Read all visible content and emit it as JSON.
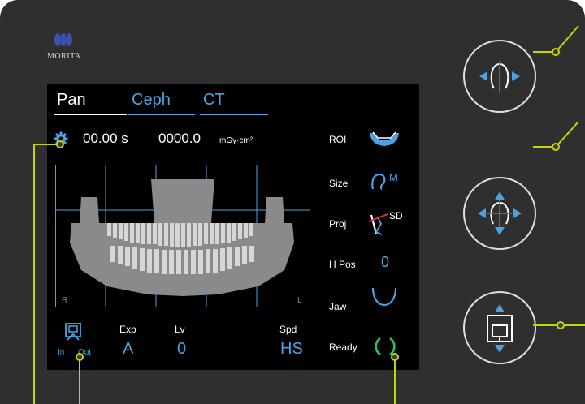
{
  "brand": {
    "name": "MORITA"
  },
  "tabs": [
    {
      "label": "Pan",
      "active": true
    },
    {
      "label": "Ceph",
      "active": false
    },
    {
      "label": "CT",
      "active": false
    }
  ],
  "status": {
    "time": "00.00 s",
    "dose": "0000.0",
    "dose_unit": "mGy·cm²"
  },
  "image": {
    "left_marker": "R",
    "right_marker": "L"
  },
  "settings": {
    "roi": "ROI",
    "size": "Size",
    "size_value": "M",
    "proj": "Proj",
    "proj_value": "SD",
    "hpos": "H Pos",
    "hpos_value": "0",
    "jaw": "Jaw",
    "ready": "Ready"
  },
  "bottom": {
    "inout_in": "In",
    "inout_out": "Out",
    "exp_label": "Exp",
    "exp_value": "A",
    "lv_label": "Lv",
    "lv_value": "0",
    "spd_label": "Spd",
    "spd_value": "HS"
  },
  "colors": {
    "accent": "#4aa3e0",
    "leader": "#c8d400",
    "panel": "#2f2f2f"
  }
}
